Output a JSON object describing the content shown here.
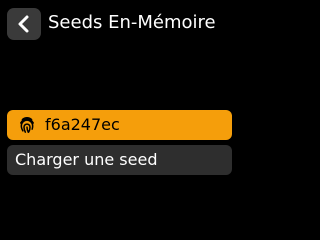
{
  "header": {
    "back_icon": "chevron-left-icon",
    "title": "Seeds En-Mémoire"
  },
  "menu": {
    "items": [
      {
        "label": "f6a247ec",
        "icon": "fingerprint-icon",
        "selected": true
      },
      {
        "label": "Charger une seed",
        "selected": false
      }
    ]
  },
  "colors": {
    "background": "#000000",
    "accent": "#f59e0b",
    "button_bg": "#3a3a3a",
    "item_bg": "#2e2e2e",
    "text": "#ffffff"
  }
}
